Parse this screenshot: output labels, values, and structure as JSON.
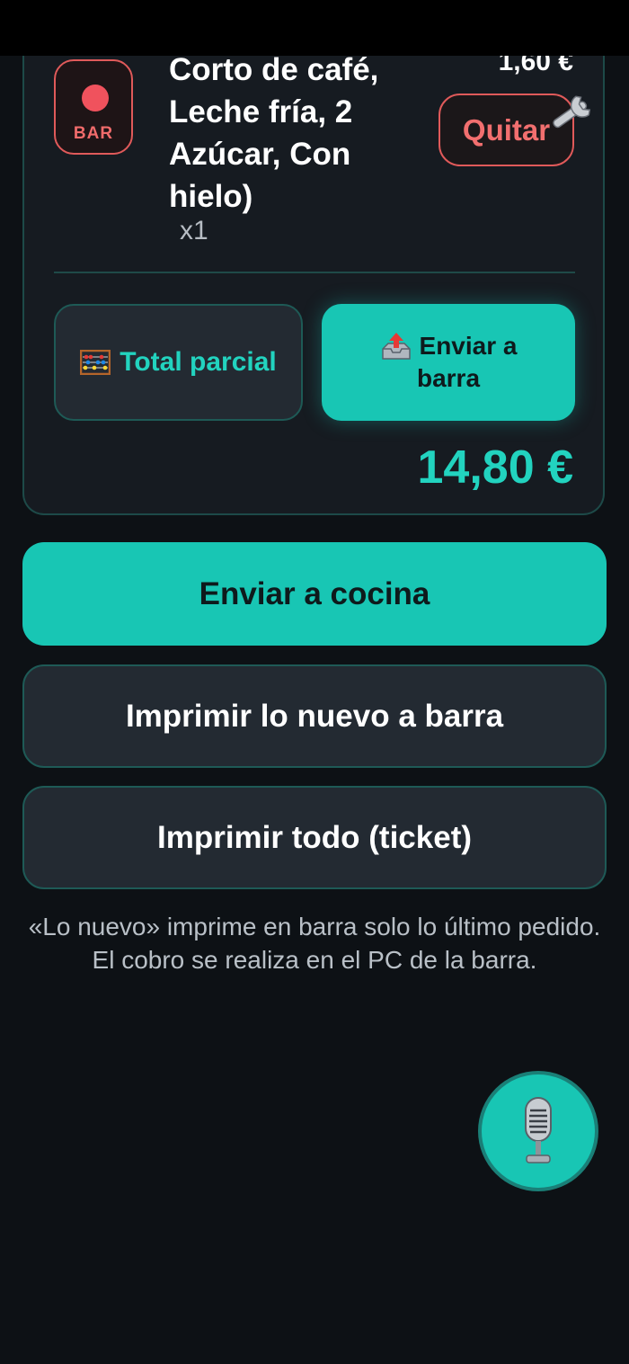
{
  "order": {
    "badge_label": "BAR",
    "item_name": "Corto de café,\nLeche fría, 2\nAzúcar, Con\nhielo)",
    "item_price": "1,60 €",
    "item_qty": "x1",
    "remove_label": "Quitar",
    "subtotal_label": "Total parcial",
    "send_bar_line1": "Enviar a",
    "send_bar_line2": "barra",
    "total": "14,80 €"
  },
  "actions": {
    "send_kitchen": "Enviar a cocina",
    "print_new": "Imprimir lo nuevo a barra",
    "print_all": "Imprimir todo (ticket)"
  },
  "footnote": "«Lo nuevo» imprime en barra solo lo último pedido. El cobro se realiza en el PC de la barra.",
  "icons": {
    "badge": "red-dot-icon",
    "remove_overlay": "wrench-icon",
    "subtotal": "abacus-icon",
    "send_bar": "outbox-tray-icon",
    "voice": "microphone-icon"
  },
  "colors": {
    "accent": "#18c6b4",
    "accent_text": "#22d3bf",
    "danger": "#f26f6f",
    "background": "#0d1115",
    "card": "#161b21"
  }
}
